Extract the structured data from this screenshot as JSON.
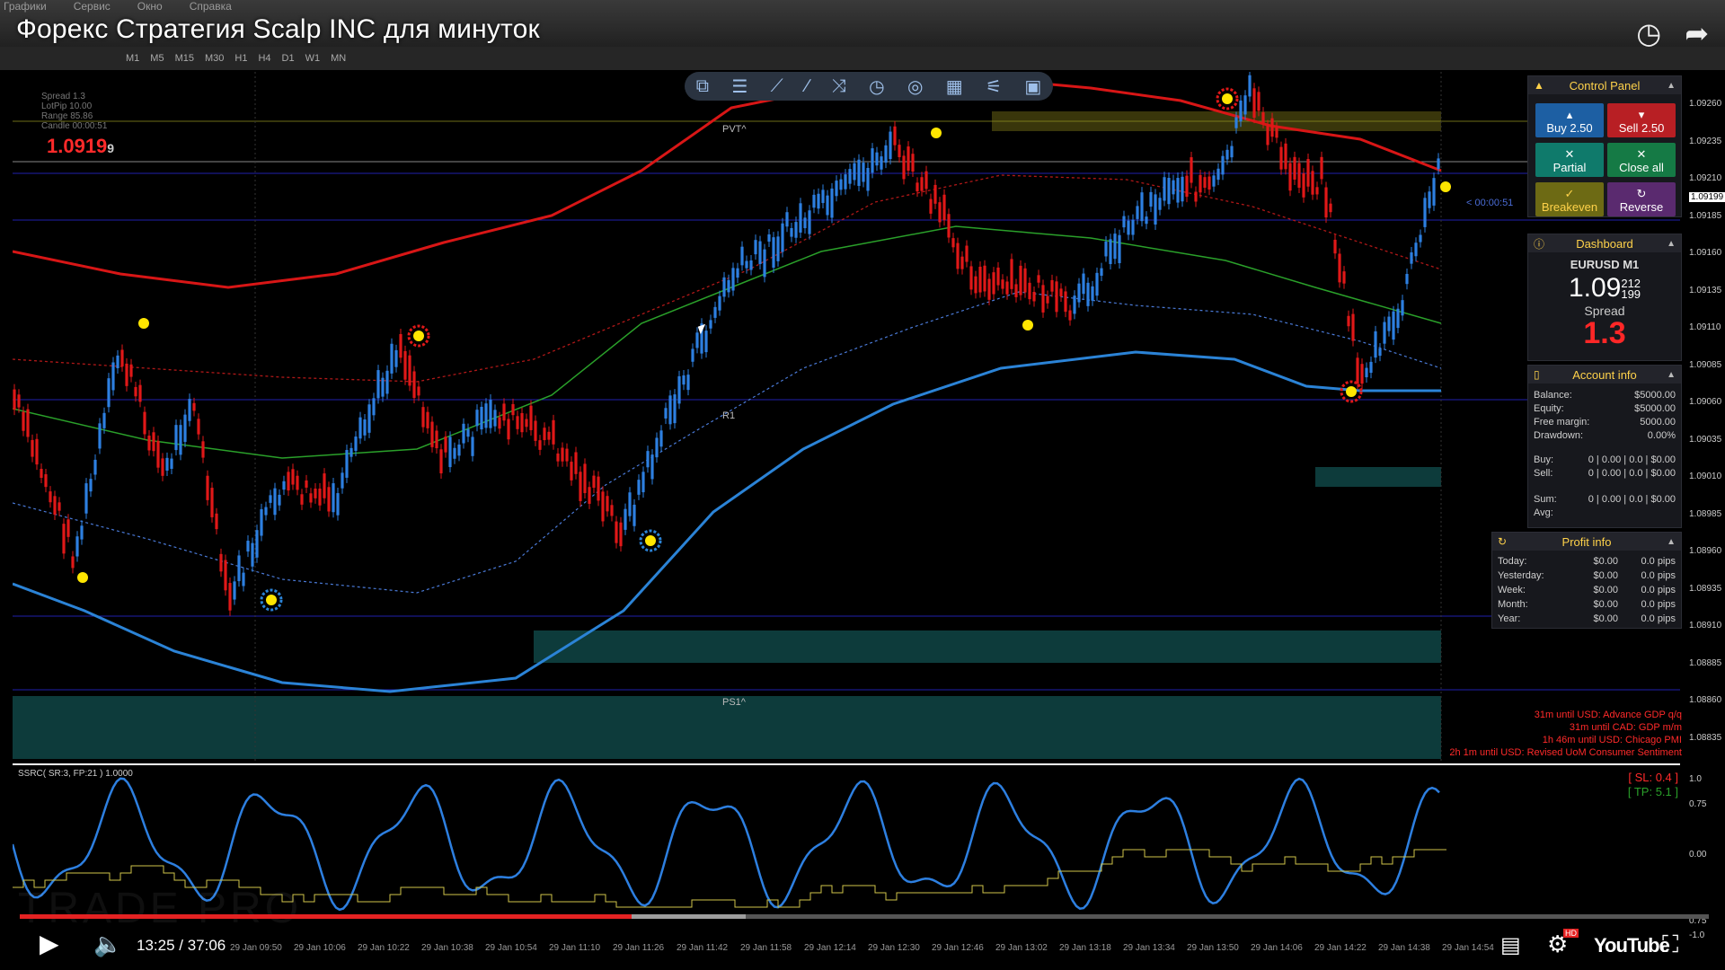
{
  "menu": [
    "Графики",
    "Сервис",
    "Окно",
    "Справка"
  ],
  "video_title": "Форекс Стратегия Scalp INC для минуток",
  "timeframes": [
    "M1",
    "M5",
    "M15",
    "M30",
    "H1",
    "H4",
    "D1",
    "W1",
    "MN"
  ],
  "info": {
    "lines": [
      "Spread 1.3",
      "LotPip 10.00",
      "Range 85.86",
      "Candle 00:00:51"
    ],
    "price_main": "1.0919",
    "price_small": "9"
  },
  "levels": {
    "pvt": "PVT^",
    "r1": "R1",
    "ps1": "PS1^",
    "countdown": "< 00:00:51"
  },
  "control_panel": {
    "title": "Control Panel",
    "buy": "Buy 2.50",
    "sell": "Sell 2.50",
    "partial": "Partial",
    "close_all": "Close all",
    "breakeven": "Breakeven",
    "reverse": "Reverse"
  },
  "dashboard": {
    "title": "Dashboard",
    "symbol": "EURUSD M1",
    "price_big": "1.09",
    "price_top": "212",
    "price_bottom": "199",
    "spread_label": "Spread",
    "spread_value": "1.3"
  },
  "account_info": {
    "title": "Account info",
    "rows": [
      {
        "k": "Balance:",
        "v": "$5000.00"
      },
      {
        "k": "Equity:",
        "v": "$5000.00"
      },
      {
        "k": "Free margin:",
        "v": "5000.00"
      },
      {
        "k": "Drawdown:",
        "v": "0.00%"
      }
    ],
    "buy": {
      "k": "Buy:",
      "v": "0 | 0.00 | 0.0 | $0.00"
    },
    "sell": {
      "k": "Sell:",
      "v": "0 | 0.00 | 0.0 | $0.00"
    },
    "sum": {
      "k": "Sum:",
      "v": "0 | 0.00 | 0.0 | $0.00"
    },
    "avg": {
      "k": "Avg:",
      "v": ""
    }
  },
  "profit_info": {
    "title": "Profit info",
    "rows": [
      {
        "k": "Today:",
        "a": "$0.00",
        "b": "0.0 pips"
      },
      {
        "k": "Yesterday:",
        "a": "$0.00",
        "b": "0.0 pips"
      },
      {
        "k": "Week:",
        "a": "$0.00",
        "b": "0.0 pips"
      },
      {
        "k": "Month:",
        "a": "$0.00",
        "b": "0.0 pips"
      },
      {
        "k": "Year:",
        "a": "$0.00",
        "b": "0.0 pips"
      }
    ]
  },
  "price_axis": [
    "1.09260",
    "1.09235",
    "1.09210",
    "1.09199",
    "1.09185",
    "1.09160",
    "1.09135",
    "1.09110",
    "1.09085",
    "1.09060",
    "1.09035",
    "1.09010",
    "1.08985",
    "1.08960",
    "1.08935",
    "1.08910",
    "1.08885",
    "1.08860",
    "1.08835"
  ],
  "osc_axis": [
    "1.0",
    "0.75",
    "0.00",
    "0.75",
    "-1.0"
  ],
  "news": [
    "31m until USD: Advance GDP q/q",
    "31m until CAD: GDP m/m",
    "1h 46m until USD: Chicago PMI",
    "2h 1m until USD: Revised UoM Consumer Sentiment"
  ],
  "oscillator": {
    "label": "SSRC( SR:3, FP:21 ) 1.0000",
    "sl": "[ SL: 0.4 ]",
    "tp": "[ TP: 5.1 ]"
  },
  "time_axis": [
    "29 Jan 09:50",
    "29 Jan 10:06",
    "29 Jan 10:22",
    "29 Jan 10:38",
    "29 Jan 10:54",
    "29 Jan 11:10",
    "29 Jan 11:26",
    "29 Jan 11:42",
    "29 Jan 11:58",
    "29 Jan 12:14",
    "29 Jan 12:30",
    "29 Jan 12:46",
    "29 Jan 13:02",
    "29 Jan 13:18",
    "29 Jan 13:34",
    "29 Jan 13:50",
    "29 Jan 14:06",
    "29 Jan 14:22",
    "29 Jan 14:38",
    "29 Jan 14:54"
  ],
  "player": {
    "time": "13:25 / 37:06",
    "progress": 0.362,
    "buffered": 0.43,
    "youtube": "YouTube",
    "hd": "HD"
  },
  "watermark": "TRADE   PRO",
  "colors": {
    "bull": "#2d7fe0",
    "bear": "#e01818",
    "envelope_red": "#d81616",
    "envelope_blue": "#2b83d6",
    "mid": "#2aa02a",
    "panel_head": "#ffd24a"
  }
}
